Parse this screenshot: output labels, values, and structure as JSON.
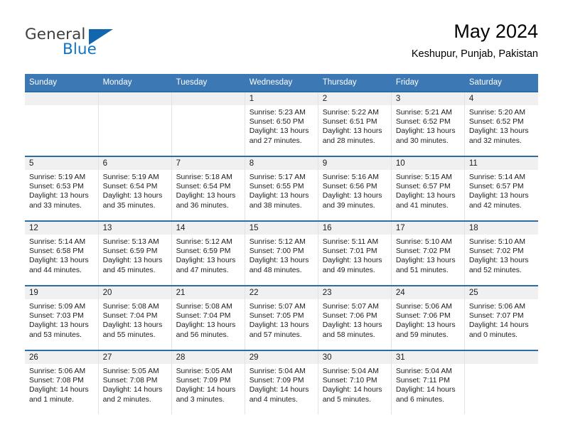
{
  "brand": {
    "name_top": "General",
    "name_bottom": "Blue"
  },
  "header": {
    "title": "May 2024",
    "subtitle": "Keshupur, Punjab, Pakistan"
  },
  "colors": {
    "header_blue": "#3c78b4",
    "row_rule_blue": "#2e6ca4",
    "daynum_band": "#f0f0f0",
    "logo_blue": "#1173c4",
    "logo_gray": "#3f3f3f"
  },
  "weekdays": [
    "Sunday",
    "Monday",
    "Tuesday",
    "Wednesday",
    "Thursday",
    "Friday",
    "Saturday"
  ],
  "labels": {
    "sunrise": "Sunrise:",
    "sunset": "Sunset:",
    "daylight": "Daylight:"
  },
  "weeks": [
    [
      {
        "day": "",
        "l1": "",
        "l2": "",
        "l3": "",
        "l4": ""
      },
      {
        "day": "",
        "l1": "",
        "l2": "",
        "l3": "",
        "l4": ""
      },
      {
        "day": "",
        "l1": "",
        "l2": "",
        "l3": "",
        "l4": ""
      },
      {
        "day": "1",
        "l1": "Sunrise: 5:23 AM",
        "l2": "Sunset: 6:50 PM",
        "l3": "Daylight: 13 hours",
        "l4": "and 27 minutes."
      },
      {
        "day": "2",
        "l1": "Sunrise: 5:22 AM",
        "l2": "Sunset: 6:51 PM",
        "l3": "Daylight: 13 hours",
        "l4": "and 28 minutes."
      },
      {
        "day": "3",
        "l1": "Sunrise: 5:21 AM",
        "l2": "Sunset: 6:52 PM",
        "l3": "Daylight: 13 hours",
        "l4": "and 30 minutes."
      },
      {
        "day": "4",
        "l1": "Sunrise: 5:20 AM",
        "l2": "Sunset: 6:52 PM",
        "l3": "Daylight: 13 hours",
        "l4": "and 32 minutes."
      }
    ],
    [
      {
        "day": "5",
        "l1": "Sunrise: 5:19 AM",
        "l2": "Sunset: 6:53 PM",
        "l3": "Daylight: 13 hours",
        "l4": "and 33 minutes."
      },
      {
        "day": "6",
        "l1": "Sunrise: 5:19 AM",
        "l2": "Sunset: 6:54 PM",
        "l3": "Daylight: 13 hours",
        "l4": "and 35 minutes."
      },
      {
        "day": "7",
        "l1": "Sunrise: 5:18 AM",
        "l2": "Sunset: 6:54 PM",
        "l3": "Daylight: 13 hours",
        "l4": "and 36 minutes."
      },
      {
        "day": "8",
        "l1": "Sunrise: 5:17 AM",
        "l2": "Sunset: 6:55 PM",
        "l3": "Daylight: 13 hours",
        "l4": "and 38 minutes."
      },
      {
        "day": "9",
        "l1": "Sunrise: 5:16 AM",
        "l2": "Sunset: 6:56 PM",
        "l3": "Daylight: 13 hours",
        "l4": "and 39 minutes."
      },
      {
        "day": "10",
        "l1": "Sunrise: 5:15 AM",
        "l2": "Sunset: 6:57 PM",
        "l3": "Daylight: 13 hours",
        "l4": "and 41 minutes."
      },
      {
        "day": "11",
        "l1": "Sunrise: 5:14 AM",
        "l2": "Sunset: 6:57 PM",
        "l3": "Daylight: 13 hours",
        "l4": "and 42 minutes."
      }
    ],
    [
      {
        "day": "12",
        "l1": "Sunrise: 5:14 AM",
        "l2": "Sunset: 6:58 PM",
        "l3": "Daylight: 13 hours",
        "l4": "and 44 minutes."
      },
      {
        "day": "13",
        "l1": "Sunrise: 5:13 AM",
        "l2": "Sunset: 6:59 PM",
        "l3": "Daylight: 13 hours",
        "l4": "and 45 minutes."
      },
      {
        "day": "14",
        "l1": "Sunrise: 5:12 AM",
        "l2": "Sunset: 6:59 PM",
        "l3": "Daylight: 13 hours",
        "l4": "and 47 minutes."
      },
      {
        "day": "15",
        "l1": "Sunrise: 5:12 AM",
        "l2": "Sunset: 7:00 PM",
        "l3": "Daylight: 13 hours",
        "l4": "and 48 minutes."
      },
      {
        "day": "16",
        "l1": "Sunrise: 5:11 AM",
        "l2": "Sunset: 7:01 PM",
        "l3": "Daylight: 13 hours",
        "l4": "and 49 minutes."
      },
      {
        "day": "17",
        "l1": "Sunrise: 5:10 AM",
        "l2": "Sunset: 7:02 PM",
        "l3": "Daylight: 13 hours",
        "l4": "and 51 minutes."
      },
      {
        "day": "18",
        "l1": "Sunrise: 5:10 AM",
        "l2": "Sunset: 7:02 PM",
        "l3": "Daylight: 13 hours",
        "l4": "and 52 minutes."
      }
    ],
    [
      {
        "day": "19",
        "l1": "Sunrise: 5:09 AM",
        "l2": "Sunset: 7:03 PM",
        "l3": "Daylight: 13 hours",
        "l4": "and 53 minutes."
      },
      {
        "day": "20",
        "l1": "Sunrise: 5:08 AM",
        "l2": "Sunset: 7:04 PM",
        "l3": "Daylight: 13 hours",
        "l4": "and 55 minutes."
      },
      {
        "day": "21",
        "l1": "Sunrise: 5:08 AM",
        "l2": "Sunset: 7:04 PM",
        "l3": "Daylight: 13 hours",
        "l4": "and 56 minutes."
      },
      {
        "day": "22",
        "l1": "Sunrise: 5:07 AM",
        "l2": "Sunset: 7:05 PM",
        "l3": "Daylight: 13 hours",
        "l4": "and 57 minutes."
      },
      {
        "day": "23",
        "l1": "Sunrise: 5:07 AM",
        "l2": "Sunset: 7:06 PM",
        "l3": "Daylight: 13 hours",
        "l4": "and 58 minutes."
      },
      {
        "day": "24",
        "l1": "Sunrise: 5:06 AM",
        "l2": "Sunset: 7:06 PM",
        "l3": "Daylight: 13 hours",
        "l4": "and 59 minutes."
      },
      {
        "day": "25",
        "l1": "Sunrise: 5:06 AM",
        "l2": "Sunset: 7:07 PM",
        "l3": "Daylight: 14 hours",
        "l4": "and 0 minutes."
      }
    ],
    [
      {
        "day": "26",
        "l1": "Sunrise: 5:06 AM",
        "l2": "Sunset: 7:08 PM",
        "l3": "Daylight: 14 hours",
        "l4": "and 1 minute."
      },
      {
        "day": "27",
        "l1": "Sunrise: 5:05 AM",
        "l2": "Sunset: 7:08 PM",
        "l3": "Daylight: 14 hours",
        "l4": "and 2 minutes."
      },
      {
        "day": "28",
        "l1": "Sunrise: 5:05 AM",
        "l2": "Sunset: 7:09 PM",
        "l3": "Daylight: 14 hours",
        "l4": "and 3 minutes."
      },
      {
        "day": "29",
        "l1": "Sunrise: 5:04 AM",
        "l2": "Sunset: 7:09 PM",
        "l3": "Daylight: 14 hours",
        "l4": "and 4 minutes."
      },
      {
        "day": "30",
        "l1": "Sunrise: 5:04 AM",
        "l2": "Sunset: 7:10 PM",
        "l3": "Daylight: 14 hours",
        "l4": "and 5 minutes."
      },
      {
        "day": "31",
        "l1": "Sunrise: 5:04 AM",
        "l2": "Sunset: 7:11 PM",
        "l3": "Daylight: 14 hours",
        "l4": "and 6 minutes."
      },
      {
        "day": "",
        "l1": "",
        "l2": "",
        "l3": "",
        "l4": ""
      }
    ]
  ]
}
